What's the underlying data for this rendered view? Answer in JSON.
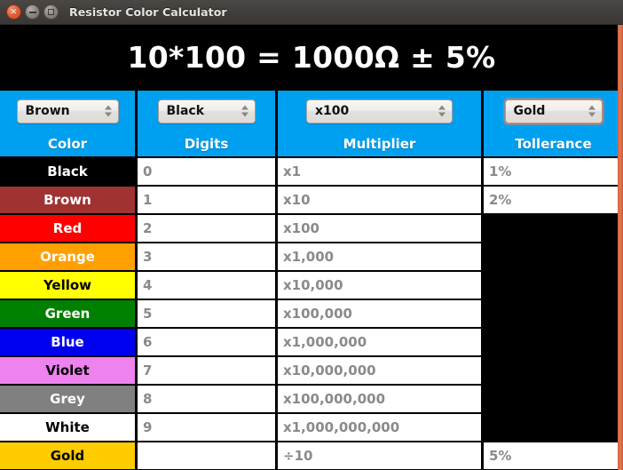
{
  "window": {
    "title": "Resistor Color Calculator",
    "controls": [
      {
        "name": "close",
        "glyph": "×"
      },
      {
        "name": "minimize",
        "glyph": ""
      },
      {
        "name": "maximize",
        "glyph": ""
      }
    ]
  },
  "result": {
    "expression": "10*100 = 1000Ω ± 5%"
  },
  "selectors": [
    {
      "name": "band-1-digit",
      "value": "Brown",
      "focused": false
    },
    {
      "name": "band-2-digit",
      "value": "Black",
      "focused": false
    },
    {
      "name": "band-3-multiplier",
      "value": "x100",
      "focused": false
    },
    {
      "name": "band-4-tolerance",
      "value": "Gold",
      "focused": true
    }
  ],
  "table": {
    "headers": [
      "Color",
      "Digits",
      "Multiplier",
      "Tollerance"
    ],
    "rows": [
      {
        "color": "Black",
        "bg": "#000000",
        "fg": "#ffffff",
        "digit": "0",
        "multiplier": "x1",
        "tolerance": "1%"
      },
      {
        "color": "Brown",
        "bg": "#A03232",
        "fg": "#ffffff",
        "digit": "1",
        "multiplier": "x10",
        "tolerance": "2%"
      },
      {
        "color": "Red",
        "bg": "#FF0000",
        "fg": "#ffffff",
        "digit": "2",
        "multiplier": "x100",
        "tolerance": ""
      },
      {
        "color": "Orange",
        "bg": "#FFA000",
        "fg": "#ffffff",
        "digit": "3",
        "multiplier": "x1,000",
        "tolerance": ""
      },
      {
        "color": "Yellow",
        "bg": "#FFFF00",
        "fg": "#000000",
        "digit": "4",
        "multiplier": "x10,000",
        "tolerance": ""
      },
      {
        "color": "Green",
        "bg": "#008000",
        "fg": "#ffffff",
        "digit": "5",
        "multiplier": "x100,000",
        "tolerance": ""
      },
      {
        "color": "Blue",
        "bg": "#0000F0",
        "fg": "#ffffff",
        "digit": "6",
        "multiplier": "x1,000,000",
        "tolerance": ""
      },
      {
        "color": "Violet",
        "bg": "#EE82EE",
        "fg": "#000000",
        "digit": "7",
        "multiplier": "x10,000,000",
        "tolerance": ""
      },
      {
        "color": "Grey",
        "bg": "#808080",
        "fg": "#ffffff",
        "digit": "8",
        "multiplier": "x100,000,000",
        "tolerance": ""
      },
      {
        "color": "White",
        "bg": "#FFFFFF",
        "fg": "#000000",
        "digit": "9",
        "multiplier": "x1,000,000,000",
        "tolerance": ""
      },
      {
        "color": "Gold",
        "bg": "#FFCC00",
        "fg": "#000000",
        "digit": "",
        "multiplier": "÷10",
        "tolerance": "5%"
      }
    ]
  }
}
